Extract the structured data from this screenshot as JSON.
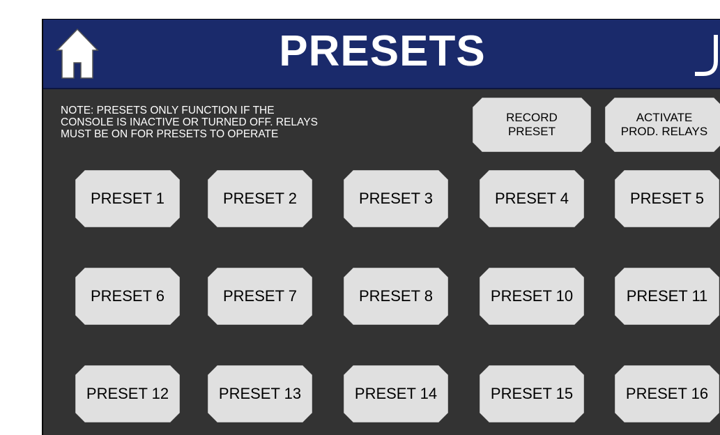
{
  "header": {
    "title": "PRESETS",
    "home_icon": "home-icon",
    "back_icon": "back-arrow-icon",
    "colors": {
      "bar": "#1a2a6b",
      "background": "#333333",
      "button": "#e0e0e0"
    }
  },
  "note": "NOTE: PRESETS ONLY FUNCTION IF THE\nCONSOLE IS INACTIVE OR TURNED OFF. RELAYS\nMUST BE ON FOR PRESETS TO OPERATE",
  "actions": {
    "record_label": "RECORD\nPRESET",
    "activate_label": "ACTIVATE\nPROD. RELAYS"
  },
  "presets": [
    "PRESET 1",
    "PRESET 2",
    "PRESET 3",
    "PRESET 4",
    "PRESET 5",
    "PRESET 6",
    "PRESET 7",
    "PRESET 8",
    "PRESET 10",
    "PRESET 11",
    "PRESET 12",
    "PRESET 13",
    "PRESET 14",
    "PRESET 15",
    "PRESET 16"
  ]
}
